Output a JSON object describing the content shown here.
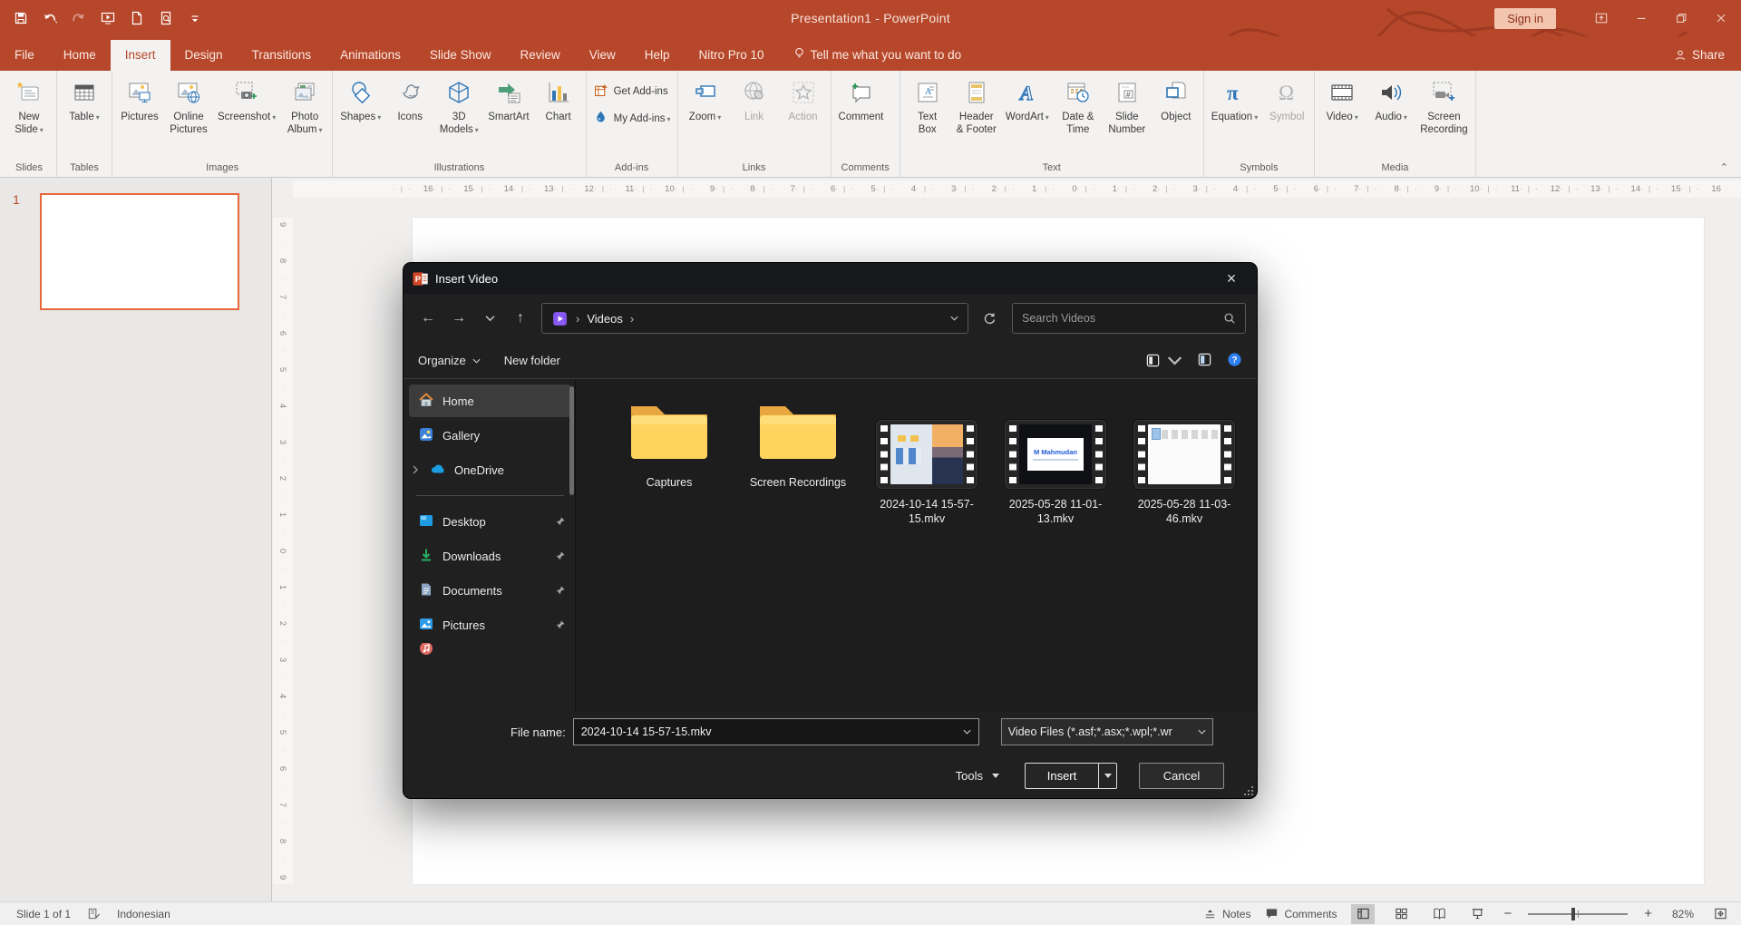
{
  "titlebar": {
    "title": "Presentation1  -  PowerPoint",
    "sign_in": "Sign in"
  },
  "tabs": [
    {
      "label": "File"
    },
    {
      "label": "Home"
    },
    {
      "label": "Insert",
      "active": true
    },
    {
      "label": "Design"
    },
    {
      "label": "Transitions"
    },
    {
      "label": "Animations"
    },
    {
      "label": "Slide Show"
    },
    {
      "label": "Review"
    },
    {
      "label": "View"
    },
    {
      "label": "Help"
    },
    {
      "label": "Nitro Pro 10"
    },
    {
      "label": "Tell me what you want to do",
      "tellme": true
    }
  ],
  "share_label": "Share",
  "ribbon": {
    "groups": [
      {
        "name": "Slides",
        "buttons": [
          {
            "label": "New\nSlide",
            "icon": "new-slide",
            "caret": true
          }
        ]
      },
      {
        "name": "Tables",
        "buttons": [
          {
            "label": "Table",
            "icon": "table",
            "caret": true
          }
        ]
      },
      {
        "name": "Images",
        "buttons": [
          {
            "label": "Pictures",
            "icon": "pictures"
          },
          {
            "label": "Online\nPictures",
            "icon": "online-pictures"
          },
          {
            "label": "Screenshot",
            "icon": "screenshot",
            "caret": true
          },
          {
            "label": "Photo\nAlbum",
            "icon": "photo-album",
            "caret": true
          }
        ]
      },
      {
        "name": "Illustrations",
        "buttons": [
          {
            "label": "Shapes",
            "icon": "shapes",
            "caret": true
          },
          {
            "label": "Icons",
            "icon": "icons"
          },
          {
            "label": "3D\nModels",
            "icon": "models-3d",
            "caret": true
          },
          {
            "label": "SmartArt",
            "icon": "smartart"
          },
          {
            "label": "Chart",
            "icon": "chart"
          }
        ]
      },
      {
        "name": "Add-ins",
        "small": true,
        "buttons": [
          {
            "label": "Get Add-ins",
            "icon": "get-addins"
          },
          {
            "label": "My Add-ins",
            "icon": "my-addins",
            "caret": true
          }
        ]
      },
      {
        "name": "Links",
        "buttons": [
          {
            "label": "Zoom",
            "icon": "zoom-presentation",
            "caret": true
          },
          {
            "label": "Link",
            "icon": "link",
            "disabled": true
          },
          {
            "label": "Action",
            "icon": "action",
            "disabled": true
          }
        ]
      },
      {
        "name": "Comments",
        "buttons": [
          {
            "label": "Comment",
            "icon": "comment"
          }
        ]
      },
      {
        "name": "Text",
        "buttons": [
          {
            "label": "Text\nBox",
            "icon": "text-box"
          },
          {
            "label": "Header\n& Footer",
            "icon": "header-footer"
          },
          {
            "label": "WordArt",
            "icon": "wordart",
            "caret": true
          },
          {
            "label": "Date &\nTime",
            "icon": "date-time"
          },
          {
            "label": "Slide\nNumber",
            "icon": "slide-number"
          },
          {
            "label": "Object",
            "icon": "object"
          }
        ]
      },
      {
        "name": "Symbols",
        "buttons": [
          {
            "label": "Equation",
            "icon": "equation",
            "caret": true
          },
          {
            "label": "Symbol",
            "icon": "symbol",
            "disabled": true
          }
        ]
      },
      {
        "name": "Media",
        "buttons": [
          {
            "label": "Video",
            "icon": "video",
            "caret": true
          },
          {
            "label": "Audio",
            "icon": "audio",
            "caret": true
          },
          {
            "label": "Screen\nRecording",
            "icon": "screen-recording"
          }
        ]
      }
    ]
  },
  "rulers": {
    "h": [
      16,
      15,
      14,
      13,
      12,
      11,
      10,
      9,
      8,
      7,
      6,
      5,
      4,
      3,
      2,
      1,
      0,
      1,
      2,
      3,
      4,
      5,
      6,
      7,
      8,
      9,
      10,
      11,
      12,
      13,
      14,
      15,
      16
    ],
    "v": [
      9,
      8,
      7,
      6,
      5,
      4,
      3,
      2,
      1,
      0,
      1,
      2,
      3,
      4,
      5,
      6,
      7,
      8,
      9
    ]
  },
  "slides_panel": {
    "slide_number": "1"
  },
  "dialog": {
    "title": "Insert Video",
    "breadcrumb_root": "Videos",
    "search_placeholder": "Search Videos",
    "toolbar": {
      "organize": "Organize",
      "new_folder": "New folder"
    },
    "sidebar": [
      {
        "label": "Home",
        "icon": "home",
        "selected": true
      },
      {
        "label": "Gallery",
        "icon": "gallery"
      },
      {
        "label": "OneDrive",
        "icon": "onedrive",
        "expander": true
      },
      {
        "divider": true
      },
      {
        "label": "Desktop",
        "icon": "desktop",
        "pinned": true
      },
      {
        "label": "Downloads",
        "icon": "downloads",
        "pinned": true
      },
      {
        "label": "Documents",
        "icon": "documents",
        "pinned": true
      },
      {
        "label": "Pictures",
        "icon": "pictures-folder",
        "pinned": true
      },
      {
        "label": "",
        "icon": "music",
        "partial": true
      }
    ],
    "files": [
      {
        "label": "Captures",
        "type": "folder"
      },
      {
        "label": "Screen Recordings",
        "type": "folder"
      },
      {
        "label": "2024-10-14 15-57-15.mkv",
        "type": "video",
        "thumb": "explorer-city"
      },
      {
        "label": "2025-05-28 11-01-13.mkv",
        "type": "video",
        "thumb": "mahmudan",
        "thumb_text": "M Mahmudan"
      },
      {
        "label": "2025-05-28 11-03-46.mkv",
        "type": "video",
        "thumb": "document"
      }
    ],
    "file_name_label": "File name:",
    "file_name_value": "2024-10-14 15-57-15.mkv",
    "file_type_value": "Video Files (*.asf;*.asx;*.wpl;*.wr",
    "buttons": {
      "tools": "Tools",
      "insert": "Insert",
      "cancel": "Cancel"
    }
  },
  "statusbar": {
    "slide_info": "Slide 1 of 1",
    "language": "Indonesian",
    "notes": "Notes",
    "comments": "Comments",
    "zoom": "82%"
  }
}
